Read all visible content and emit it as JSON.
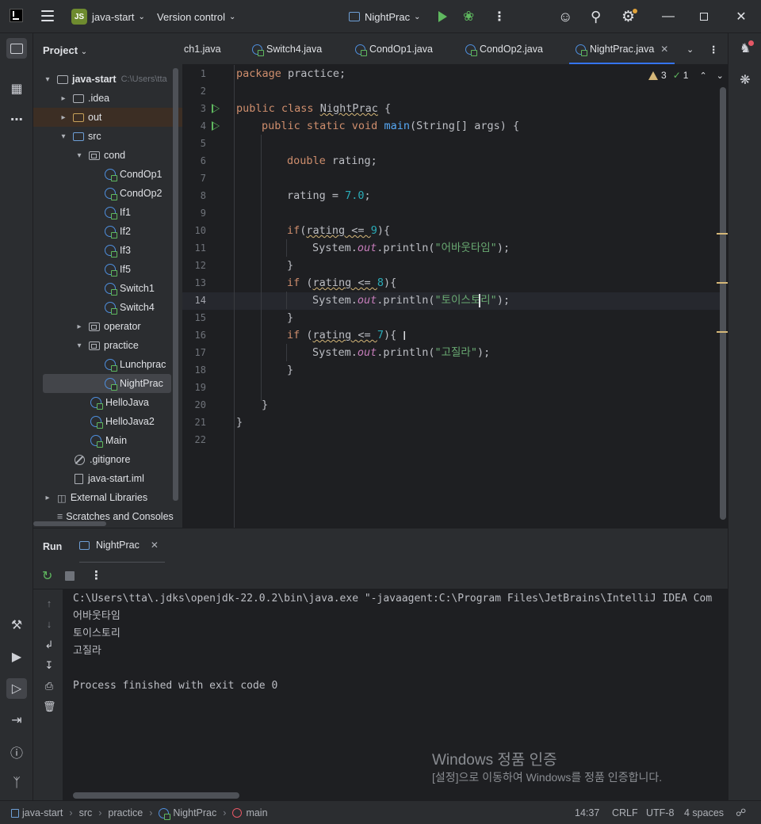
{
  "titlebar": {
    "project_badge": "JS",
    "project_name": "java-start",
    "vcs_label": "Version control",
    "run_config": "NightPrac"
  },
  "project_panel": {
    "title": "Project",
    "root_name": "java-start",
    "root_path": "C:\\Users\\tta",
    "items": [
      {
        "label": ".idea"
      },
      {
        "label": "out"
      },
      {
        "label": "src"
      },
      {
        "label": "cond"
      },
      {
        "label": "CondOp1"
      },
      {
        "label": "CondOp2"
      },
      {
        "label": "If1"
      },
      {
        "label": "If2"
      },
      {
        "label": "If3"
      },
      {
        "label": "If5"
      },
      {
        "label": "Switch1"
      },
      {
        "label": "Switch4"
      },
      {
        "label": "operator"
      },
      {
        "label": "practice"
      },
      {
        "label": "Lunchprac"
      },
      {
        "label": "NightPrac"
      },
      {
        "label": "HelloJava"
      },
      {
        "label": "HelloJava2"
      },
      {
        "label": "Main"
      },
      {
        "label": ".gitignore"
      },
      {
        "label": "java-start.iml"
      },
      {
        "label": "External Libraries"
      },
      {
        "label": "Scratches and Consoles"
      }
    ]
  },
  "tabs": [
    {
      "label": "ch1.java"
    },
    {
      "label": "Switch4.java"
    },
    {
      "label": "CondOp1.java"
    },
    {
      "label": "CondOp2.java"
    },
    {
      "label": "NightPrac.java"
    }
  ],
  "inspections": {
    "warnings": "3",
    "ok": "1"
  },
  "editor": {
    "line_numbers": [
      "1",
      "2",
      "3",
      "4",
      "5",
      "6",
      "7",
      "8",
      "9",
      "10",
      "11",
      "12",
      "13",
      "14",
      "15",
      "16",
      "17",
      "18",
      "19",
      "20",
      "21",
      "22"
    ],
    "code": {
      "l1_kw": "package",
      "l1_rest": " practice;",
      "l3_kw": "public class",
      "l3_sp": " ",
      "l3_name": "NightPrac",
      "l3_rest": " {",
      "l4_kw": "public static void",
      "l4_sp": " ",
      "l4_name": "main",
      "l4_rest": "(String[] args) {",
      "l6_kw": "double",
      "l6_rest": " rating;",
      "l8_a": "rating = ",
      "l8_num": "7.0",
      "l8_b": ";",
      "l10_kw": "if",
      "l10_a": "(",
      "l10_cond": "rating <= ",
      "l10_num": "9",
      "l10_b": "){",
      "l11_a": "System.",
      "l11_out": "out",
      "l11_b": ".println(",
      "l11_str": "\"어바웃타임\"",
      "l11_c": ");",
      "l12": "}",
      "l13_kw": "if",
      "l13_a": " (",
      "l13_cond": "rating <= ",
      "l13_num": "8",
      "l13_b": "){",
      "l14_a": "System.",
      "l14_out": "out",
      "l14_b": ".println(",
      "l14_str": "\"토이스토리\"",
      "l14_c": ");",
      "l15": "}",
      "l16_kw": "if",
      "l16_a": " (",
      "l16_cond": "rating <= ",
      "l16_num": "7",
      "l16_b": "){",
      "l17_a": "System.",
      "l17_out": "out",
      "l17_b": ".println(",
      "l17_str": "\"고질라\"",
      "l17_c": ");",
      "l18": "}",
      "l20": "}",
      "l21": "}"
    }
  },
  "run_panel": {
    "title": "Run",
    "tab_label": "NightPrac",
    "console_lines": [
      "C:\\Users\\tta\\.jdks\\openjdk-22.0.2\\bin\\java.exe \"-javaagent:C:\\Program Files\\JetBrains\\IntelliJ IDEA Com",
      "어바웃타임",
      "토이스토리",
      "고질라",
      "",
      "Process finished with exit code 0"
    ],
    "watermark_title": "Windows 정품 인증",
    "watermark_text": "[설정]으로 이동하여 Windows를 정품 인증합니다."
  },
  "statusbar": {
    "breadcrumbs": [
      "java-start",
      "src",
      "practice",
      "NightPrac",
      "main"
    ],
    "position": "14:37",
    "line_sep": "CRLF",
    "encoding": "UTF-8",
    "indent": "4 spaces"
  },
  "colors": {
    "accent": "#3574f0",
    "keyword": "#cf8e6d",
    "string": "#6aab73",
    "number": "#2aacb8",
    "run_green": "#5fb85f",
    "warning": "#d5b778"
  }
}
